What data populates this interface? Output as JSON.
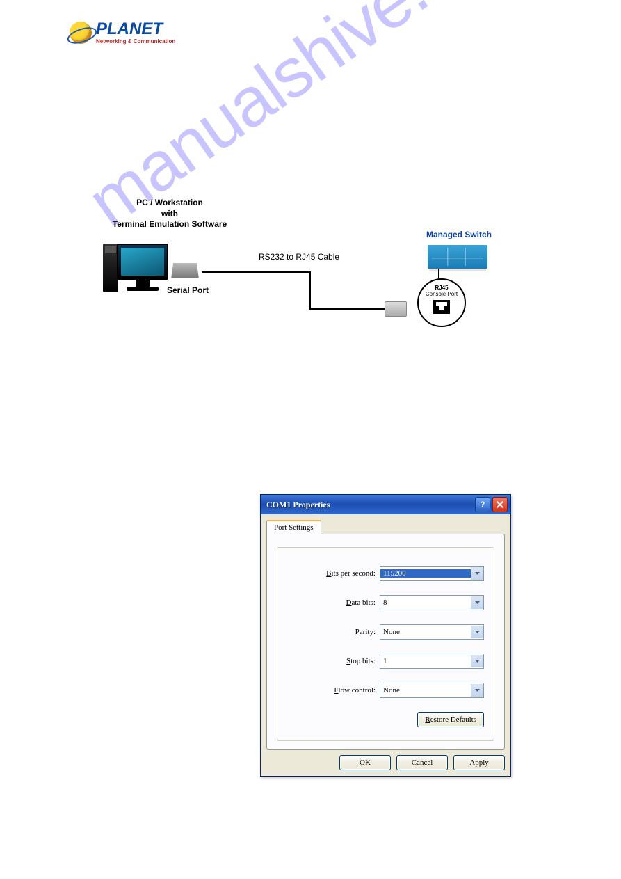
{
  "logo": {
    "brand": "PLANET",
    "tagline": "Networking & Communication"
  },
  "diagram": {
    "pc_label_l1": "PC / Workstation",
    "pc_label_l2": "with",
    "pc_label_l3": "Terminal Emulation Software",
    "serial_port": "Serial Port",
    "cable_label": "RS232 to RJ45 Cable",
    "switch_label": "Managed Switch",
    "callout_l1": "RJ45",
    "callout_l2": "Console Port"
  },
  "watermark": "manualshive.com",
  "dialog": {
    "title": "COM1 Properties",
    "tab": "Port Settings",
    "fields": {
      "bits_per_second": {
        "label": "Bits per second:",
        "hotkey": "B",
        "value": "115200"
      },
      "data_bits": {
        "label": "Data bits:",
        "hotkey": "D",
        "value": "8"
      },
      "parity": {
        "label": "Parity:",
        "hotkey": "P",
        "value": "None"
      },
      "stop_bits": {
        "label": "Stop bits:",
        "hotkey": "S",
        "value": "1"
      },
      "flow_control": {
        "label": "Flow control:",
        "hotkey": "F",
        "value": "None"
      }
    },
    "restore": "Restore Defaults",
    "restore_hotkey": "R",
    "ok": "OK",
    "cancel": "Cancel",
    "apply": "Apply",
    "apply_hotkey": "A",
    "help_glyph": "?"
  }
}
